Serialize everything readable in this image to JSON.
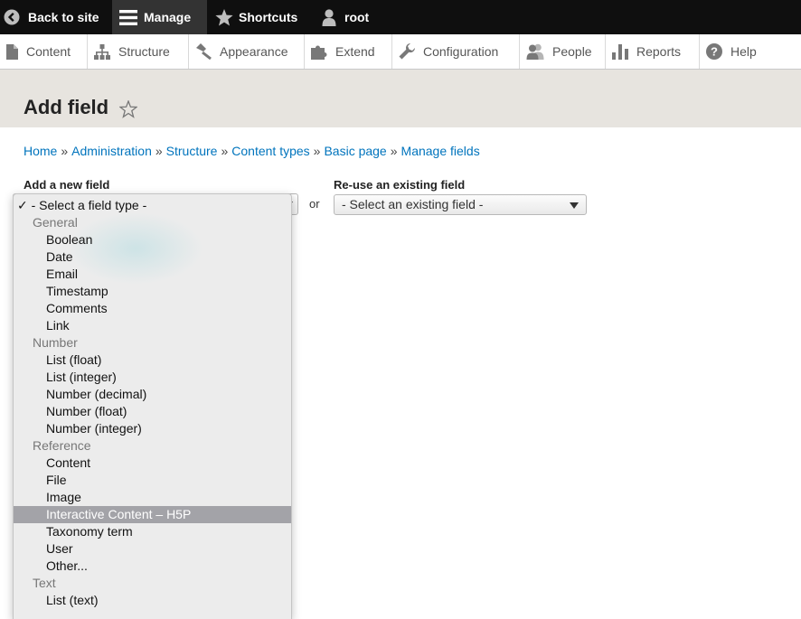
{
  "toolbar": {
    "back_label": "Back to site",
    "manage_label": "Manage",
    "shortcuts_label": "Shortcuts",
    "user_label": "root"
  },
  "tray": {
    "content": "Content",
    "structure": "Structure",
    "appearance": "Appearance",
    "extend": "Extend",
    "configuration": "Configuration",
    "people": "People",
    "reports": "Reports",
    "help": "Help"
  },
  "page": {
    "title": "Add field"
  },
  "breadcrumb": {
    "home": "Home",
    "administration": "Administration",
    "structure": "Structure",
    "content_types": "Content types",
    "basic_page": "Basic page",
    "manage_fields": "Manage fields",
    "separator": "»"
  },
  "form": {
    "new_field_label": "Add a new field",
    "or": "or",
    "reuse_label": "Re-use an existing field",
    "reuse_value": "- Select an existing field -"
  },
  "dropdown": {
    "selected": "✓ - Select a field type -",
    "options": [
      "General",
      "Boolean",
      "Date",
      "Email",
      "Timestamp",
      "Comments",
      "Link",
      "Number",
      "List (float)",
      "List (integer)",
      "Number (decimal)",
      "Number (float)",
      "Number (integer)",
      "Reference",
      "Content",
      "File",
      "Image",
      "Interactive Content – H5P",
      "Taxonomy term",
      "User",
      "Other...",
      "Text",
      "List (text)"
    ]
  }
}
